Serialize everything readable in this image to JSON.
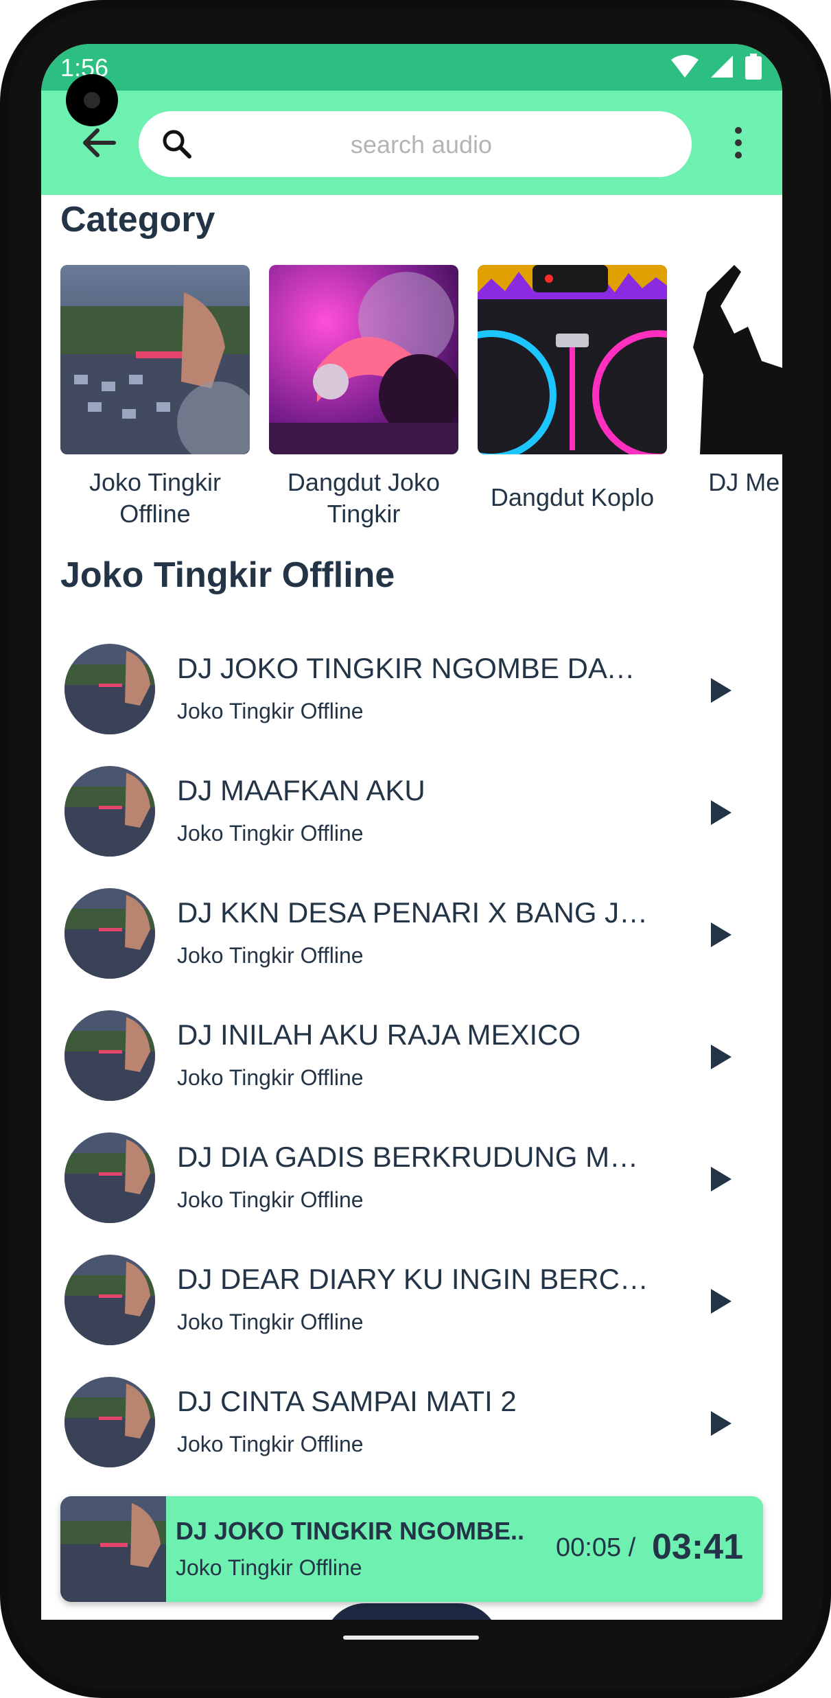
{
  "status_bar": {
    "time": "1:56"
  },
  "app_bar": {
    "search_placeholder": "search audio"
  },
  "category_section": {
    "title": "Category",
    "items": [
      {
        "label": "Joko Tingkir Offline"
      },
      {
        "label": "Dangdut Joko Tingkir"
      },
      {
        "label": "Dangdut Koplo"
      },
      {
        "label": "DJ Me Tanpo"
      }
    ]
  },
  "playlist": {
    "title": "Joko Tingkir Offline",
    "songs": [
      {
        "title": "DJ JOKO TINGKIR NGOMBE DAWET",
        "artist": "Joko Tingkir Offline"
      },
      {
        "title": "DJ MAAFKAN AKU",
        "artist": "Joko Tingkir Offline"
      },
      {
        "title": "DJ KKN DESA PENARI X BANG JO...",
        "artist": "Joko Tingkir Offline"
      },
      {
        "title": "DJ INILAH AKU RAJA MEXICO",
        "artist": "Joko Tingkir Offline"
      },
      {
        "title": "DJ DIA GADIS BERKRUDUNG MER...",
        "artist": "Joko Tingkir Offline"
      },
      {
        "title": "DJ DEAR DIARY KU INGIN BERCER...",
        "artist": "Joko Tingkir Offline"
      },
      {
        "title": "DJ CINTA SAMPAI MATI 2",
        "artist": "Joko Tingkir Offline"
      }
    ]
  },
  "mini_player": {
    "title": "DJ JOKO TINGKIR NGOMBE..",
    "artist": "Joko Tingkir Offline",
    "current_time": "00:05 /",
    "total_time": "03:41"
  },
  "colors": {
    "accent": "#6ef0b1",
    "status_bar": "#2dbf82",
    "text": "#243447"
  }
}
